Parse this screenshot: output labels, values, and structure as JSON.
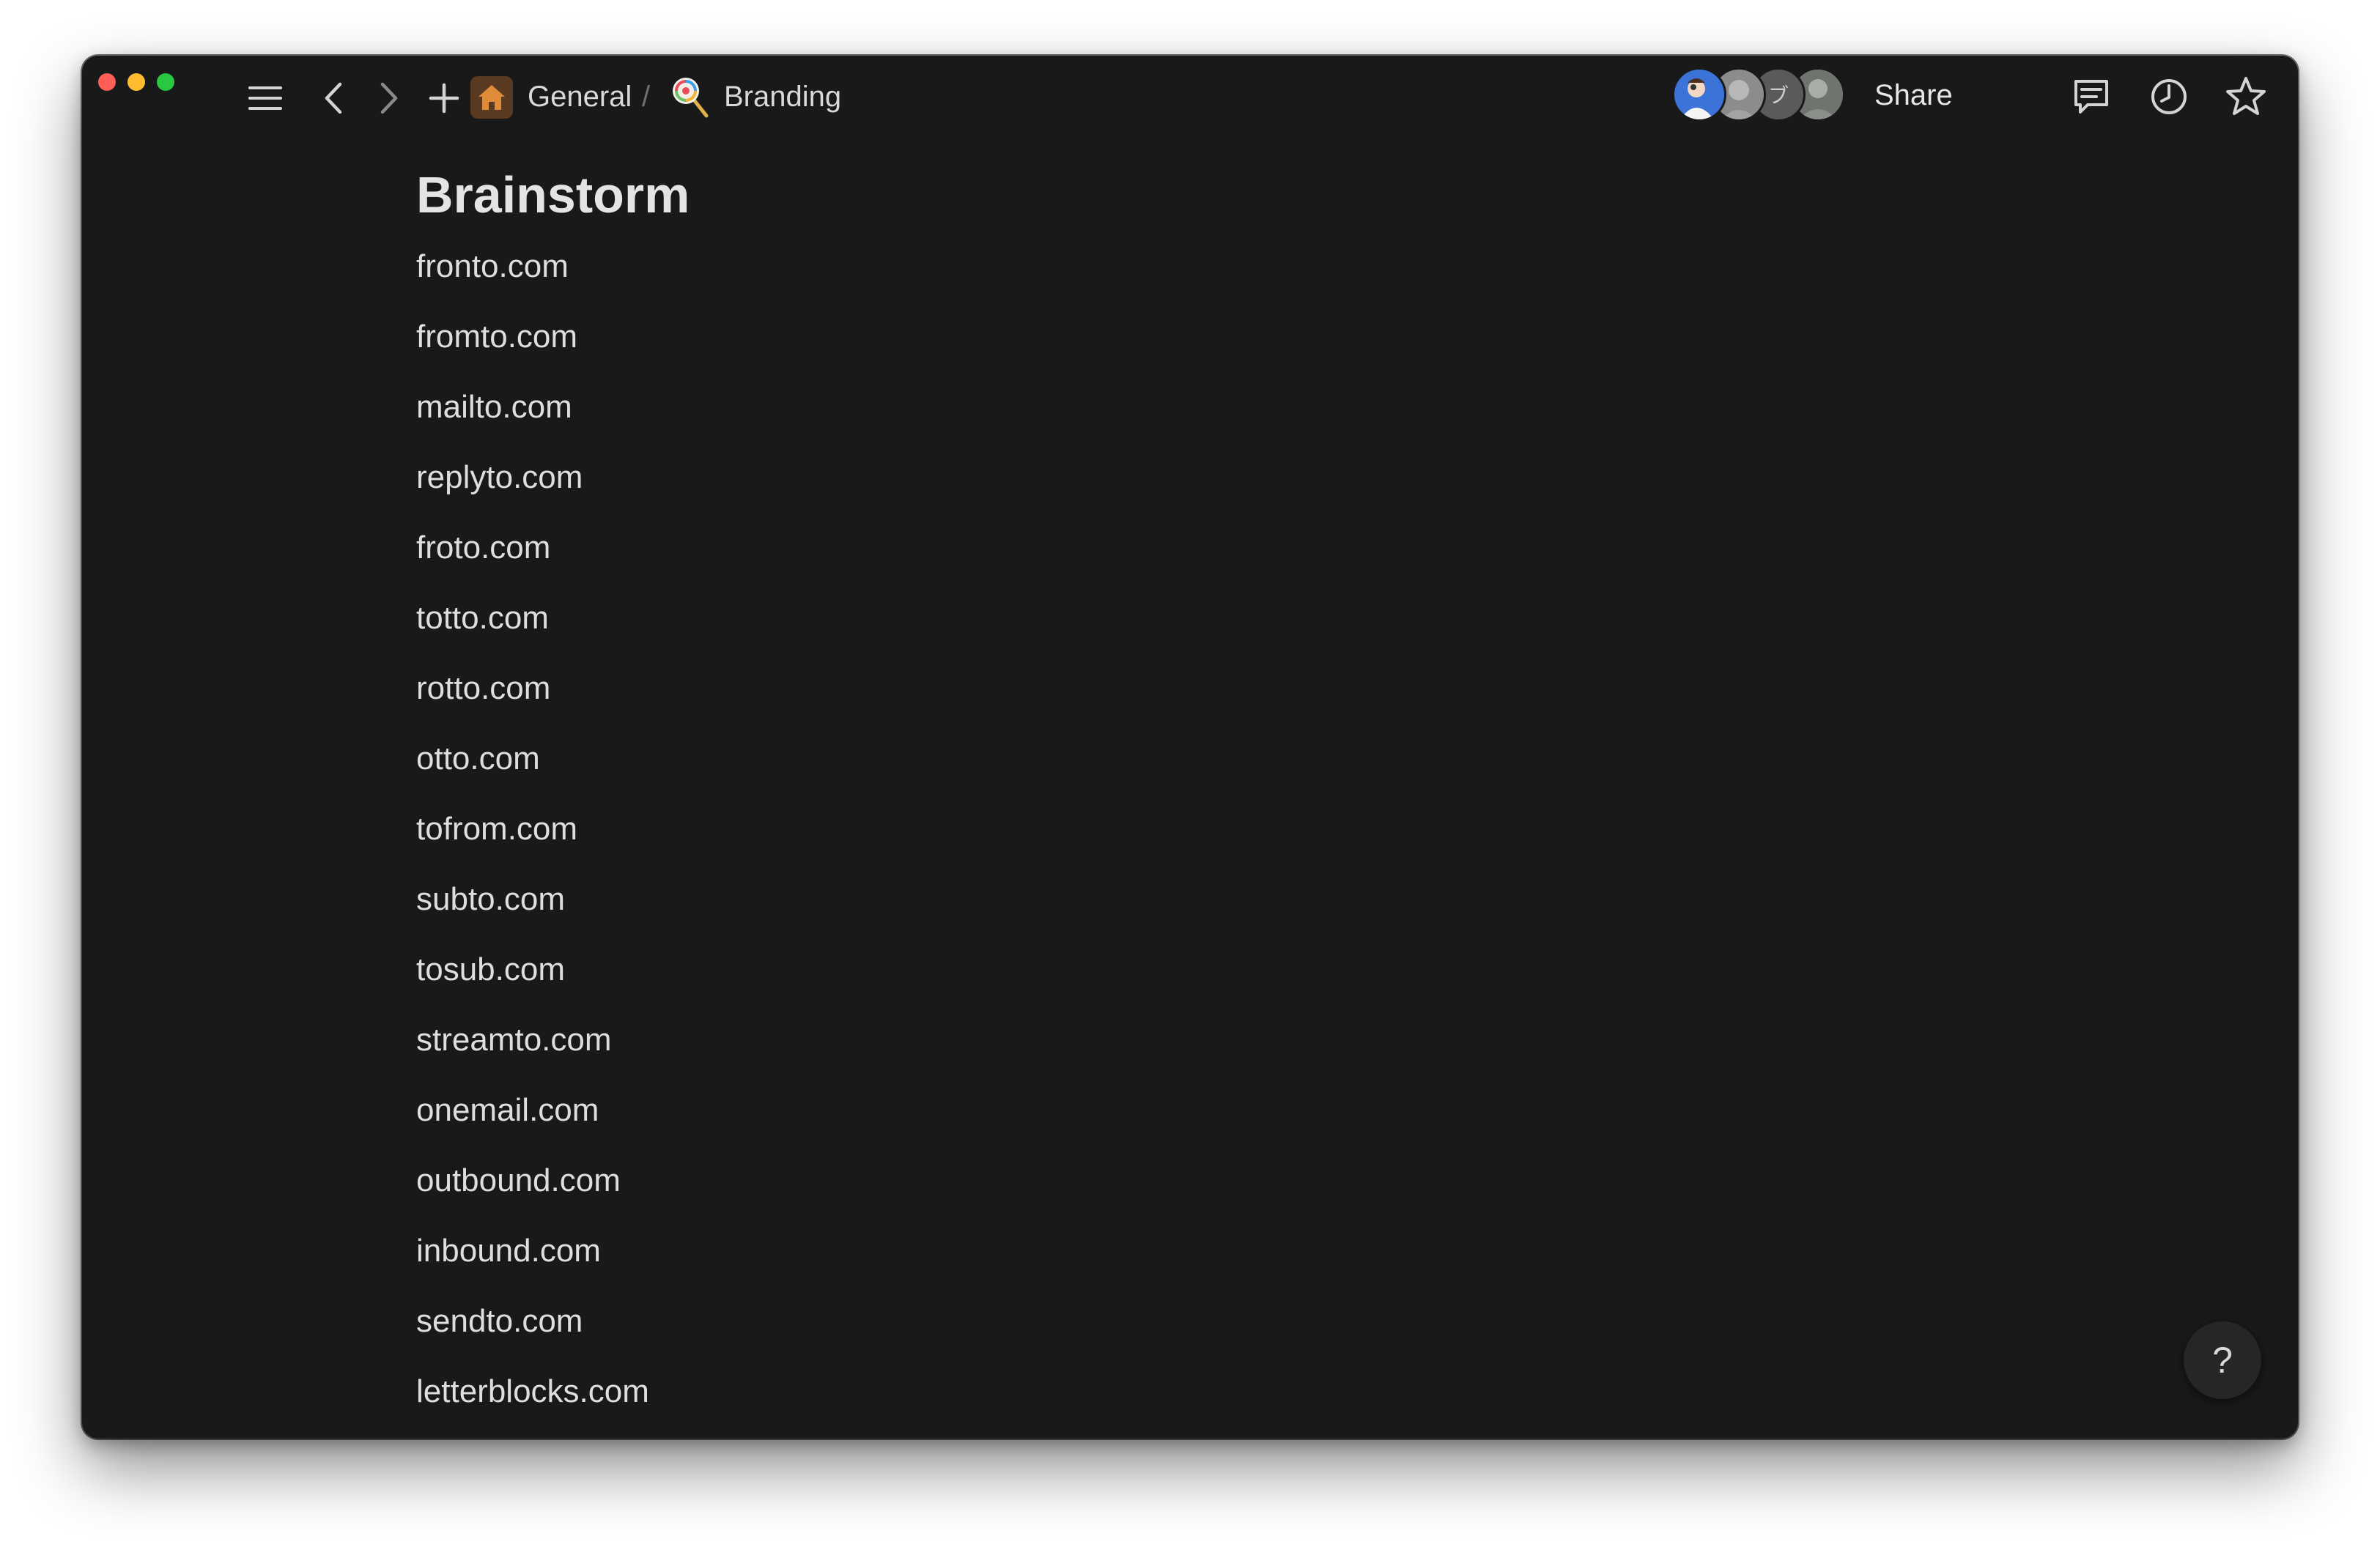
{
  "window": {
    "controls": [
      "close",
      "minimize",
      "zoom"
    ]
  },
  "toolbar": {
    "sidebar_toggle_icon": "menu-icon",
    "back_icon": "chevron-left-icon",
    "forward_icon": "chevron-right-icon",
    "new_page_icon": "plus-icon",
    "share_label": "Share",
    "comments_icon": "comment-icon",
    "history_icon": "clock-icon",
    "favorite_icon": "star-icon",
    "more_icon": "ellipsis-icon"
  },
  "breadcrumb": {
    "items": [
      {
        "label": "General",
        "icon": "house-icon"
      },
      {
        "label": "Branding",
        "icon": "lollipop-icon"
      }
    ],
    "separator": "/"
  },
  "collaborators": {
    "count": 4,
    "initial_3": "ブ"
  },
  "page": {
    "title": "Brainstorm",
    "items": [
      "fronto.com",
      "fromto.com",
      "mailto.com",
      "replyto.com",
      "froto.com",
      "totto.com",
      "rotto.com",
      "otto.com",
      "tofrom.com",
      "subto.com",
      "tosub.com",
      "streamto.com",
      "onemail.com",
      "outbound.com",
      "inbound.com",
      "sendto.com",
      "letterblocks.com"
    ]
  },
  "help": {
    "label": "?"
  },
  "colors": {
    "background": "#191919",
    "text": "#dedede",
    "home_tile": "#5b3a22",
    "home_glyph": "#e08b3a"
  }
}
